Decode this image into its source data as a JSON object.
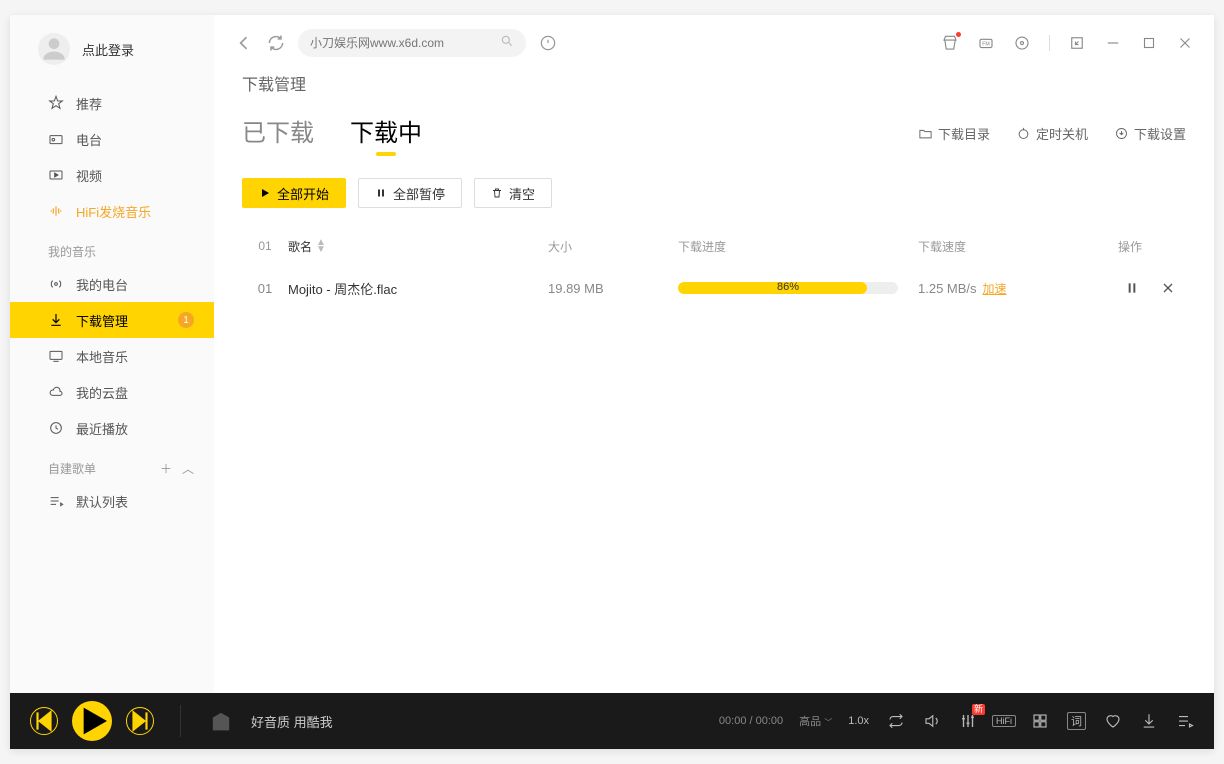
{
  "sidebar": {
    "login_text": "点此登录",
    "nav1": [
      {
        "label": "推荐"
      },
      {
        "label": "电台"
      },
      {
        "label": "视频"
      },
      {
        "label": "HiFi发烧音乐"
      }
    ],
    "my_music_header": "我的音乐",
    "nav2": [
      {
        "label": "我的电台"
      },
      {
        "label": "下载管理",
        "badge": "1"
      },
      {
        "label": "本地音乐"
      },
      {
        "label": "我的云盘"
      },
      {
        "label": "最近播放"
      }
    ],
    "playlist_header": "自建歌单",
    "nav3": [
      {
        "label": "默认列表"
      }
    ]
  },
  "topbar": {
    "search_placeholder": "小刀娱乐网www.x6d.com"
  },
  "page": {
    "title": "下载管理",
    "tabs": {
      "downloaded": "已下载",
      "downloading": "下载中"
    },
    "actions": {
      "dir": "下载目录",
      "shutdown": "定时关机",
      "settings": "下载设置"
    },
    "toolbar": {
      "start_all": "全部开始",
      "pause_all": "全部暂停",
      "clear": "清空"
    },
    "columns": {
      "idx": "01",
      "name": "歌名",
      "size": "大小",
      "progress": "下载进度",
      "speed": "下载速度",
      "ops": "操作"
    },
    "rows": [
      {
        "idx": "01",
        "name": "Mojito - 周杰伦.flac",
        "size": "19.89 MB",
        "progress_pct": 86,
        "progress_label": "86%",
        "speed": "1.25 MB/s",
        "accel": "加速"
      }
    ]
  },
  "player": {
    "slogan": "好音质 用酷我",
    "time": "00:00 / 00:00",
    "quality": "高品",
    "speed": "1.0x",
    "hifi": "HiFi",
    "lyrics": "词",
    "new_badge": "新"
  },
  "colors": {
    "accent": "#ffd400",
    "orange": "#f5a623"
  }
}
